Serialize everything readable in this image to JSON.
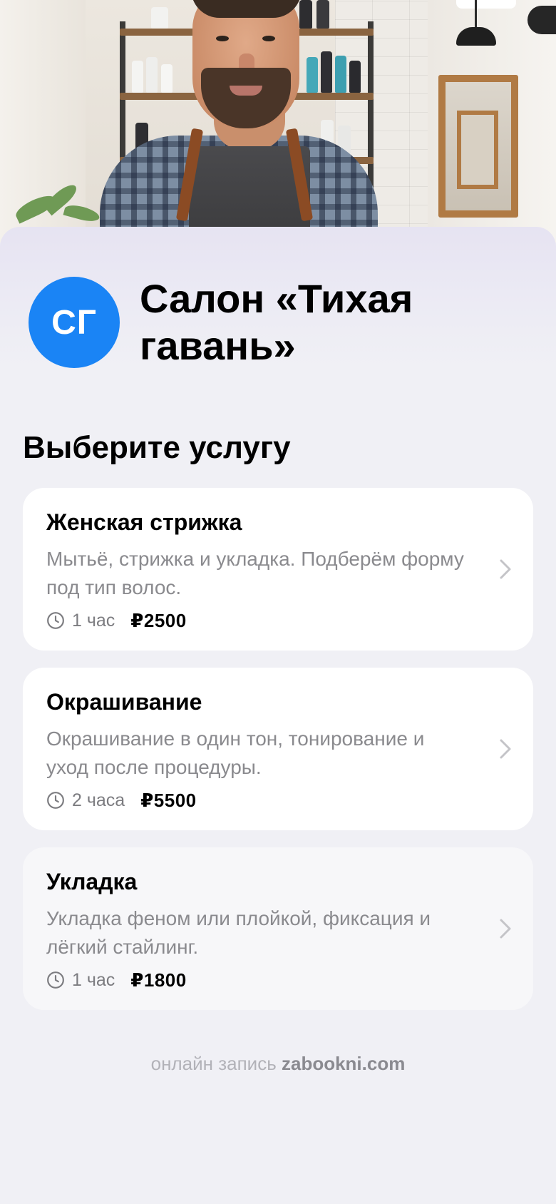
{
  "hero": {
    "image_alt": ""
  },
  "salon": {
    "initials": "СГ",
    "name": "Салон «Тихая гавань»"
  },
  "section": {
    "title": "Выберите услугу"
  },
  "services": [
    {
      "title": "Женская стрижка",
      "description": "Мытьё, стрижка и укладка. Подберём форму под тип волос.",
      "duration": "1 час",
      "price": "₽2500"
    },
    {
      "title": "Окрашивание",
      "description": "Окрашивание в один тон, тонирование и уход после процедуры.",
      "duration": "2 часа",
      "price": "₽5500"
    },
    {
      "title": "Укладка",
      "description": "Укладка феном или плойкой, фиксация и лёгкий стайлинг.",
      "duration": "1 час",
      "price": "₽1800"
    }
  ],
  "footer": {
    "prefix": "онлайн запись",
    "brand": "zabookni.com"
  },
  "colors": {
    "accent": "#1a84f5",
    "background": "#f0f0f5",
    "card": "#ffffff",
    "muted_text": "#8a8a8e"
  },
  "icons": [
    "clock-icon",
    "chevron-right-icon"
  ]
}
